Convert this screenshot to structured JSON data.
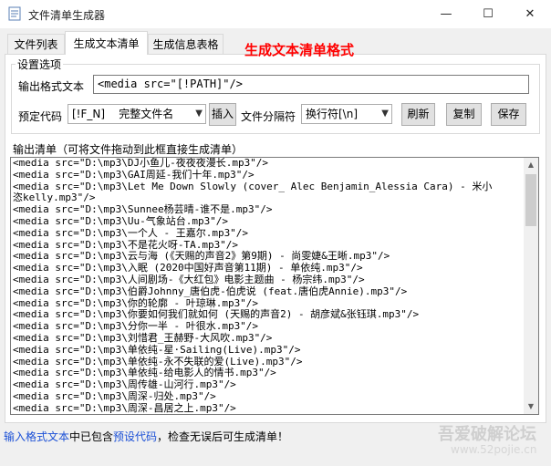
{
  "window": {
    "title": "文件清单生成器",
    "min_glyph": "—",
    "max_glyph": "☐",
    "close_glyph": "✕"
  },
  "tabs": [
    {
      "label": "文件列表",
      "active": false
    },
    {
      "label": "生成文本清单",
      "active": true
    },
    {
      "label": "生成信息表格",
      "active": false
    }
  ],
  "heading": "生成文本清单格式",
  "settings": {
    "legend": "设置选项",
    "format_label": "输出格式文本",
    "format_value": "<media src=\"[!PATH]\"/>",
    "preset_label": "预定代码",
    "preset_value": "[!F_N]    完整文件名",
    "insert_button": "插入",
    "separator_label": "文件分隔符",
    "separator_value": "换行符[\\n]",
    "refresh_button": "刷新",
    "copy_button": "复制",
    "save_button": "保存"
  },
  "output": {
    "label": "输出清单（可将文件拖动到此框直接生成清单）",
    "lines": [
      "<media src=\"D:\\mp3\\DJ小鱼儿-夜夜夜漫长.mp3\"/>",
      "<media src=\"D:\\mp3\\GAI周延-我们十年.mp3\"/>",
      "<media src=\"D:\\mp3\\Let Me Down Slowly (cover_ Alec Benjamin_Alessia Cara) - 米小",
      "恣kelly.mp3\"/>",
      "<media src=\"D:\\mp3\\Sunnee杨芸晴-谁不是.mp3\"/>",
      "<media src=\"D:\\mp3\\Uu-气象站台.mp3\"/>",
      "<media src=\"D:\\mp3\\一个人 - 王嘉尔.mp3\"/>",
      "<media src=\"D:\\mp3\\不是花火呀-TA.mp3\"/>",
      "<media src=\"D:\\mp3\\云与海 (《天赐的声音2》第9期) - 尚雯婕&王晰.mp3\"/>",
      "<media src=\"D:\\mp3\\入眠 (2020中国好声音第11期) - 单依纯.mp3\"/>",
      "<media src=\"D:\\mp3\\人间剧场-《大红包》电影主题曲 - 杨宗纬.mp3\"/>",
      "<media src=\"D:\\mp3\\伯爵Johnny_唐伯虎-伯虎说 (feat.唐伯虎Annie).mp3\"/>",
      "<media src=\"D:\\mp3\\你的轮廓 - 叶琼琳.mp3\"/>",
      "<media src=\"D:\\mp3\\你要如何我们就如何 (天赐的声音2) - 胡彦斌&张钰琪.mp3\"/>",
      "<media src=\"D:\\mp3\\分你一半 - 叶很水.mp3\"/>",
      "<media src=\"D:\\mp3\\刘惜君_王赫野-大风吹.mp3\"/>",
      "<media src=\"D:\\mp3\\单依纯-星·Sailing(Live).mp3\"/>",
      "<media src=\"D:\\mp3\\单依纯-永不失联的爱(Live).mp3\"/>",
      "<media src=\"D:\\mp3\\单依纯-给电影人的情书.mp3\"/>",
      "<media src=\"D:\\mp3\\周传雄-山河行.mp3\"/>",
      "<media src=\"D:\\mp3\\周深-归处.mp3\"/>",
      "<media src=\"D:\\mp3\\周深-昌居之上.mp3\"/>"
    ]
  },
  "status": {
    "part1": "输入格式文本",
    "part2": "中已包含",
    "part3": "预设代码",
    "part4": "，检查无误后可生成清单！"
  },
  "watermark": {
    "main": "吾爱破解论坛",
    "url": "www.52pojie.cn"
  },
  "colors": {
    "heading_red": "#ff0000",
    "status_link_blue": "#1a4fd6",
    "window_bg": "#f0f0f0"
  }
}
